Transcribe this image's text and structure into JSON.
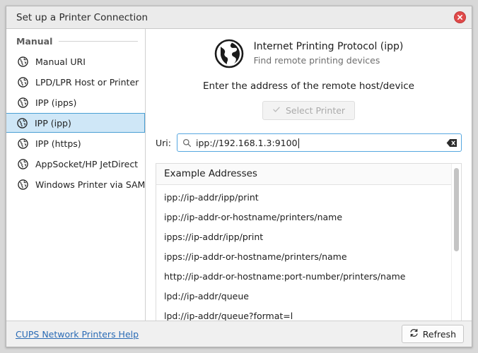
{
  "window": {
    "title": "Set up a Printer Connection",
    "close_icon": "close-icon"
  },
  "sidebar": {
    "group_label": "Manual",
    "items": [
      {
        "label": "Manual URI",
        "icon": "globe-icon",
        "selected": false
      },
      {
        "label": "LPD/LPR Host or Printer",
        "icon": "globe-icon",
        "selected": false
      },
      {
        "label": "IPP (ipps)",
        "icon": "globe-icon",
        "selected": false
      },
      {
        "label": "IPP (ipp)",
        "icon": "globe-icon",
        "selected": true
      },
      {
        "label": "IPP (https)",
        "icon": "globe-icon",
        "selected": false
      },
      {
        "label": "AppSocket/HP JetDirect",
        "icon": "globe-icon",
        "selected": false
      },
      {
        "label": "Windows Printer via SAMBA",
        "icon": "globe-icon",
        "selected": false
      }
    ]
  },
  "main": {
    "protocol_icon": "globe-icon",
    "protocol_title": "Internet Printing Protocol (ipp)",
    "protocol_subtitle": "Find remote printing devices",
    "prompt": "Enter the address of the remote host/device",
    "select_printer_label": "Select Printer",
    "select_printer_icon": "check-icon",
    "uri_label": "Uri:",
    "uri_value": "ipp://192.168.1.3:9100",
    "uri_placeholder": "",
    "uri_search_icon": "search-icon",
    "uri_clear_icon": "backspace-clear-icon",
    "examples_title": "Example Addresses",
    "examples": [
      "ipp://ip-addr/ipp/print",
      "ipp://ip-addr-or-hostname/printers/name",
      "ipps://ip-addr/ipp/print",
      "ipps://ip-addr-or-hostname/printers/name",
      "http://ip-addr-or-hostname:port-number/printers/name",
      "lpd://ip-addr/queue",
      "lpd://ip-addr/queue?format=l"
    ]
  },
  "footer": {
    "help_label": "CUPS Network Printers Help",
    "refresh_label": "Refresh",
    "refresh_icon": "refresh-icon"
  },
  "colors": {
    "accent_blue": "#56a7e0",
    "selection_bg": "#cfe7f7",
    "link_blue": "#2a6bb5",
    "close_red": "#e04a4a",
    "titlebar_bg": "#ebebeb",
    "footer_bg": "#f0f0f0"
  }
}
